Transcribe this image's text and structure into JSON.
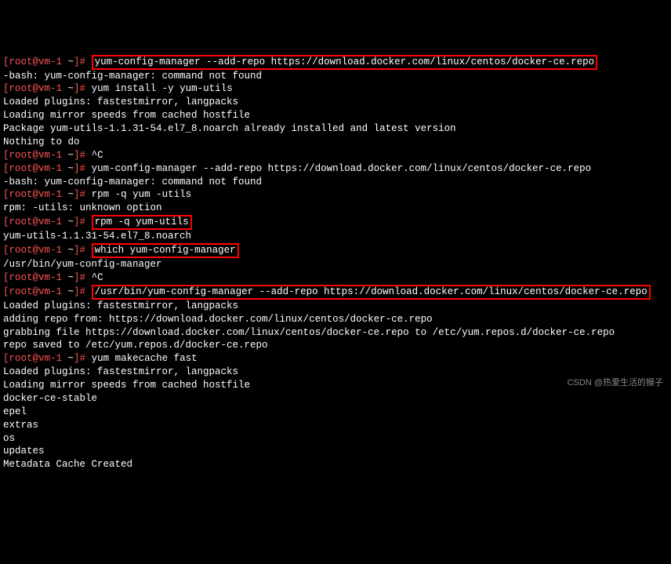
{
  "prompt": {
    "user_host": "[root@vm-1",
    "path": "~",
    "end": "]#"
  },
  "lines": [
    {
      "type": "cmd_hl",
      "text": "yum-config-manager --add-repo https://download.docker.com/linux/centos/docker-ce.repo"
    },
    {
      "type": "out",
      "text": "-bash: yum-config-manager: command not found"
    },
    {
      "type": "cmd",
      "text": "yum install -y yum-utils"
    },
    {
      "type": "out",
      "text": "Loaded plugins: fastestmirror, langpacks"
    },
    {
      "type": "out",
      "text": "Loading mirror speeds from cached hostfile"
    },
    {
      "type": "out",
      "text": "Package yum-utils-1.1.31-54.el7_8.noarch already installed and latest version"
    },
    {
      "type": "out",
      "text": "Nothing to do"
    },
    {
      "type": "cmd",
      "text": "^C"
    },
    {
      "type": "cmd",
      "text": "yum-config-manager --add-repo https://download.docker.com/linux/centos/docker-ce.repo"
    },
    {
      "type": "out",
      "text": "-bash: yum-config-manager: command not found"
    },
    {
      "type": "cmd",
      "text": "rpm -q yum -utils"
    },
    {
      "type": "out",
      "text": "rpm: -utils: unknown option"
    },
    {
      "type": "cmd_hl",
      "text": "rpm -q yum-utils"
    },
    {
      "type": "out",
      "text": "yum-utils-1.1.31-54.el7_8.noarch"
    },
    {
      "type": "cmd_hl",
      "text": "which yum-config-manager"
    },
    {
      "type": "out",
      "text": "/usr/bin/yum-config-manager"
    },
    {
      "type": "cmd",
      "text": "^C"
    },
    {
      "type": "cmd_hl",
      "text": "/usr/bin/yum-config-manager --add-repo https://download.docker.com/linux/centos/docker-ce.repo"
    },
    {
      "type": "out",
      "text": "Loaded plugins: fastestmirror, langpacks"
    },
    {
      "type": "out",
      "text": "adding repo from: https://download.docker.com/linux/centos/docker-ce.repo"
    },
    {
      "type": "out",
      "text": "grabbing file https://download.docker.com/linux/centos/docker-ce.repo to /etc/yum.repos.d/docker-ce.repo"
    },
    {
      "type": "out",
      "text": "repo saved to /etc/yum.repos.d/docker-ce.repo"
    },
    {
      "type": "cmd",
      "text": "yum makecache fast"
    },
    {
      "type": "out",
      "text": "Loaded plugins: fastestmirror, langpacks"
    },
    {
      "type": "out",
      "text": "Loading mirror speeds from cached hostfile"
    },
    {
      "type": "out",
      "text": "docker-ce-stable"
    },
    {
      "type": "out",
      "text": "epel"
    },
    {
      "type": "out",
      "text": "extras"
    },
    {
      "type": "out",
      "text": "os"
    },
    {
      "type": "out",
      "text": "updates"
    },
    {
      "type": "out",
      "text": "Metadata Cache Created"
    }
  ],
  "watermark": "CSDN @热爱生活的猴子"
}
